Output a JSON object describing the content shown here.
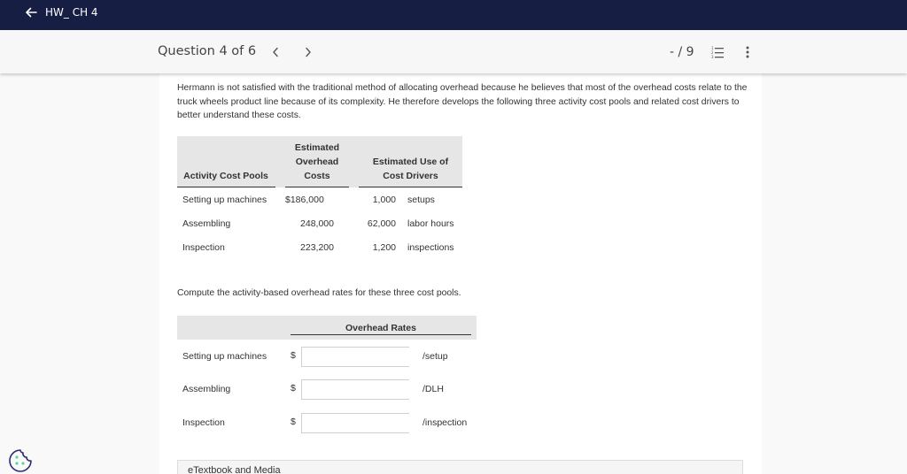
{
  "topbar": {
    "title": "HW_ CH 4",
    "back_icon": "arrow-left-icon",
    "colors": {
      "background": "#161e43",
      "text": "#ffffff"
    }
  },
  "question_bar": {
    "title": "Question 4 of 6",
    "prev_icon": "chevron-left-icon",
    "next_icon": "chevron-right-icon",
    "score": "- / 9",
    "list_icon": "numbered-list-icon",
    "more_icon": "vertical-ellipsis-icon"
  },
  "question": {
    "paragraph": "Hermann is not satisfied with the traditional method of allocating overhead because he believes that most of the overhead costs relate to the truck wheels product line because of its complexity. He therefore develops the following three activity cost pools and related cost drivers to better understand these costs.",
    "table": {
      "headers": {
        "pool": "Activity Cost Pools",
        "costs_l1": "Estimated",
        "costs_l2": "Overhead",
        "costs_l3": "Costs",
        "drivers_l1": "Estimated Use of",
        "drivers_l2": "Cost Drivers"
      },
      "rows": [
        {
          "pool": "Setting up machines",
          "cost": "$186,000",
          "use": "1,000",
          "driver": "setups"
        },
        {
          "pool": "Assembling",
          "cost": "248,000",
          "use": "62,000",
          "driver": "labor hours"
        },
        {
          "pool": "Inspection",
          "cost": "223,200",
          "use": "1,200",
          "driver": "inspections"
        }
      ]
    },
    "instruction": "Compute the activity-based overhead rates for these three cost pools.",
    "answer_table": {
      "header": "Overhead Rates",
      "rows": [
        {
          "pool": "Setting up machines",
          "currency": "$",
          "value": "",
          "unit": "/setup"
        },
        {
          "pool": "Assembling",
          "currency": "$",
          "value": "",
          "unit": "/DLH"
        },
        {
          "pool": "Inspection",
          "currency": "$",
          "value": "",
          "unit": "/inspection"
        }
      ]
    }
  },
  "etextbook": {
    "label": "eTextbook and Media"
  },
  "cookie": {
    "icon": "cookie-icon"
  }
}
